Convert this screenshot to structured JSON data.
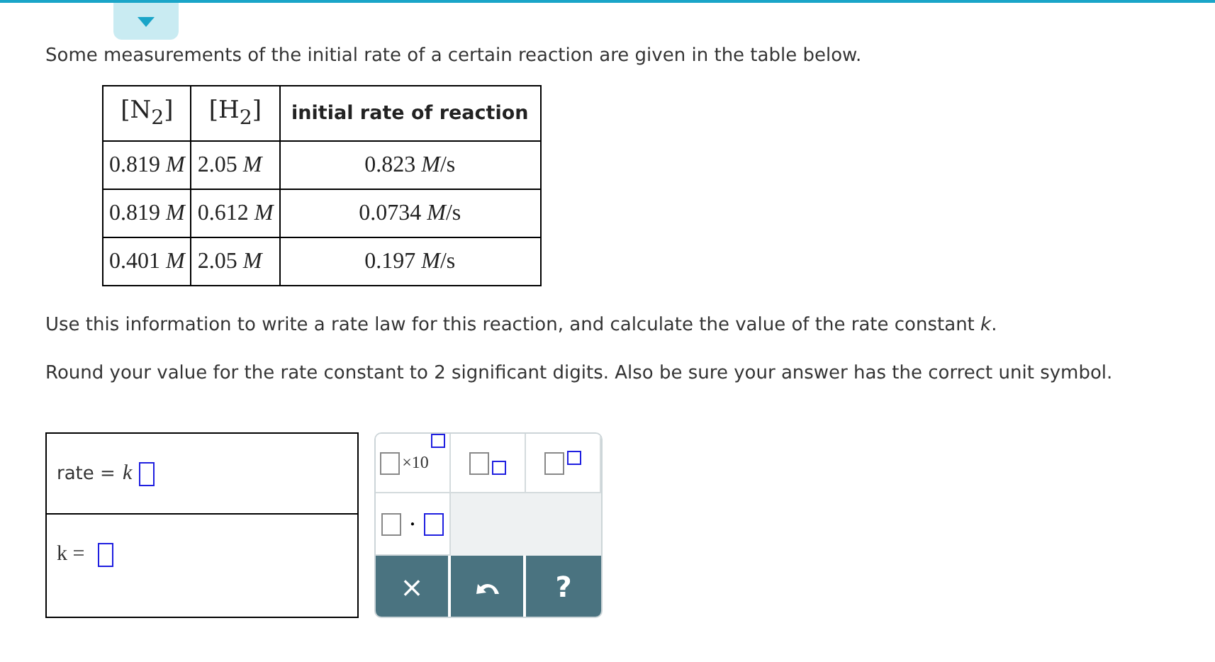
{
  "intro": "Some measurements of the initial rate of a certain reaction are given in the table below.",
  "table": {
    "columns": [
      "[N$_{2}$]",
      "[H$_{2}$]",
      "initial rate of reaction"
    ],
    "rows": [
      [
        "0.819 *M*",
        "2.05 *M*",
        "0.823 *M*/s"
      ],
      [
        "0.819 *M*",
        "0.612 *M*",
        "0.0734 *M*/s"
      ],
      [
        "0.401 *M*",
        "2.05 *M*",
        "0.197 *M*/s"
      ]
    ]
  },
  "instructions": [
    "Use this information to write a rate law for this reaction, and calculate the value of the rate constant *k*.",
    "Round your value for the rate constant to 2 significant digits. Also be sure your answer has the correct unit symbol."
  ],
  "answers": [
    {
      "label": "rate =",
      "factor": "k"
    },
    {
      "label": "k ="
    }
  ],
  "palette": {
    "templates": [
      {
        "kind": "power10",
        "text": "×10"
      },
      {
        "kind": "subscript"
      },
      {
        "kind": "superscript"
      },
      {
        "kind": "dot",
        "text": "·"
      }
    ],
    "actions": [
      {
        "kind": "clear",
        "text": "×"
      },
      {
        "kind": "undo"
      },
      {
        "kind": "help",
        "text": "?"
      }
    ]
  }
}
